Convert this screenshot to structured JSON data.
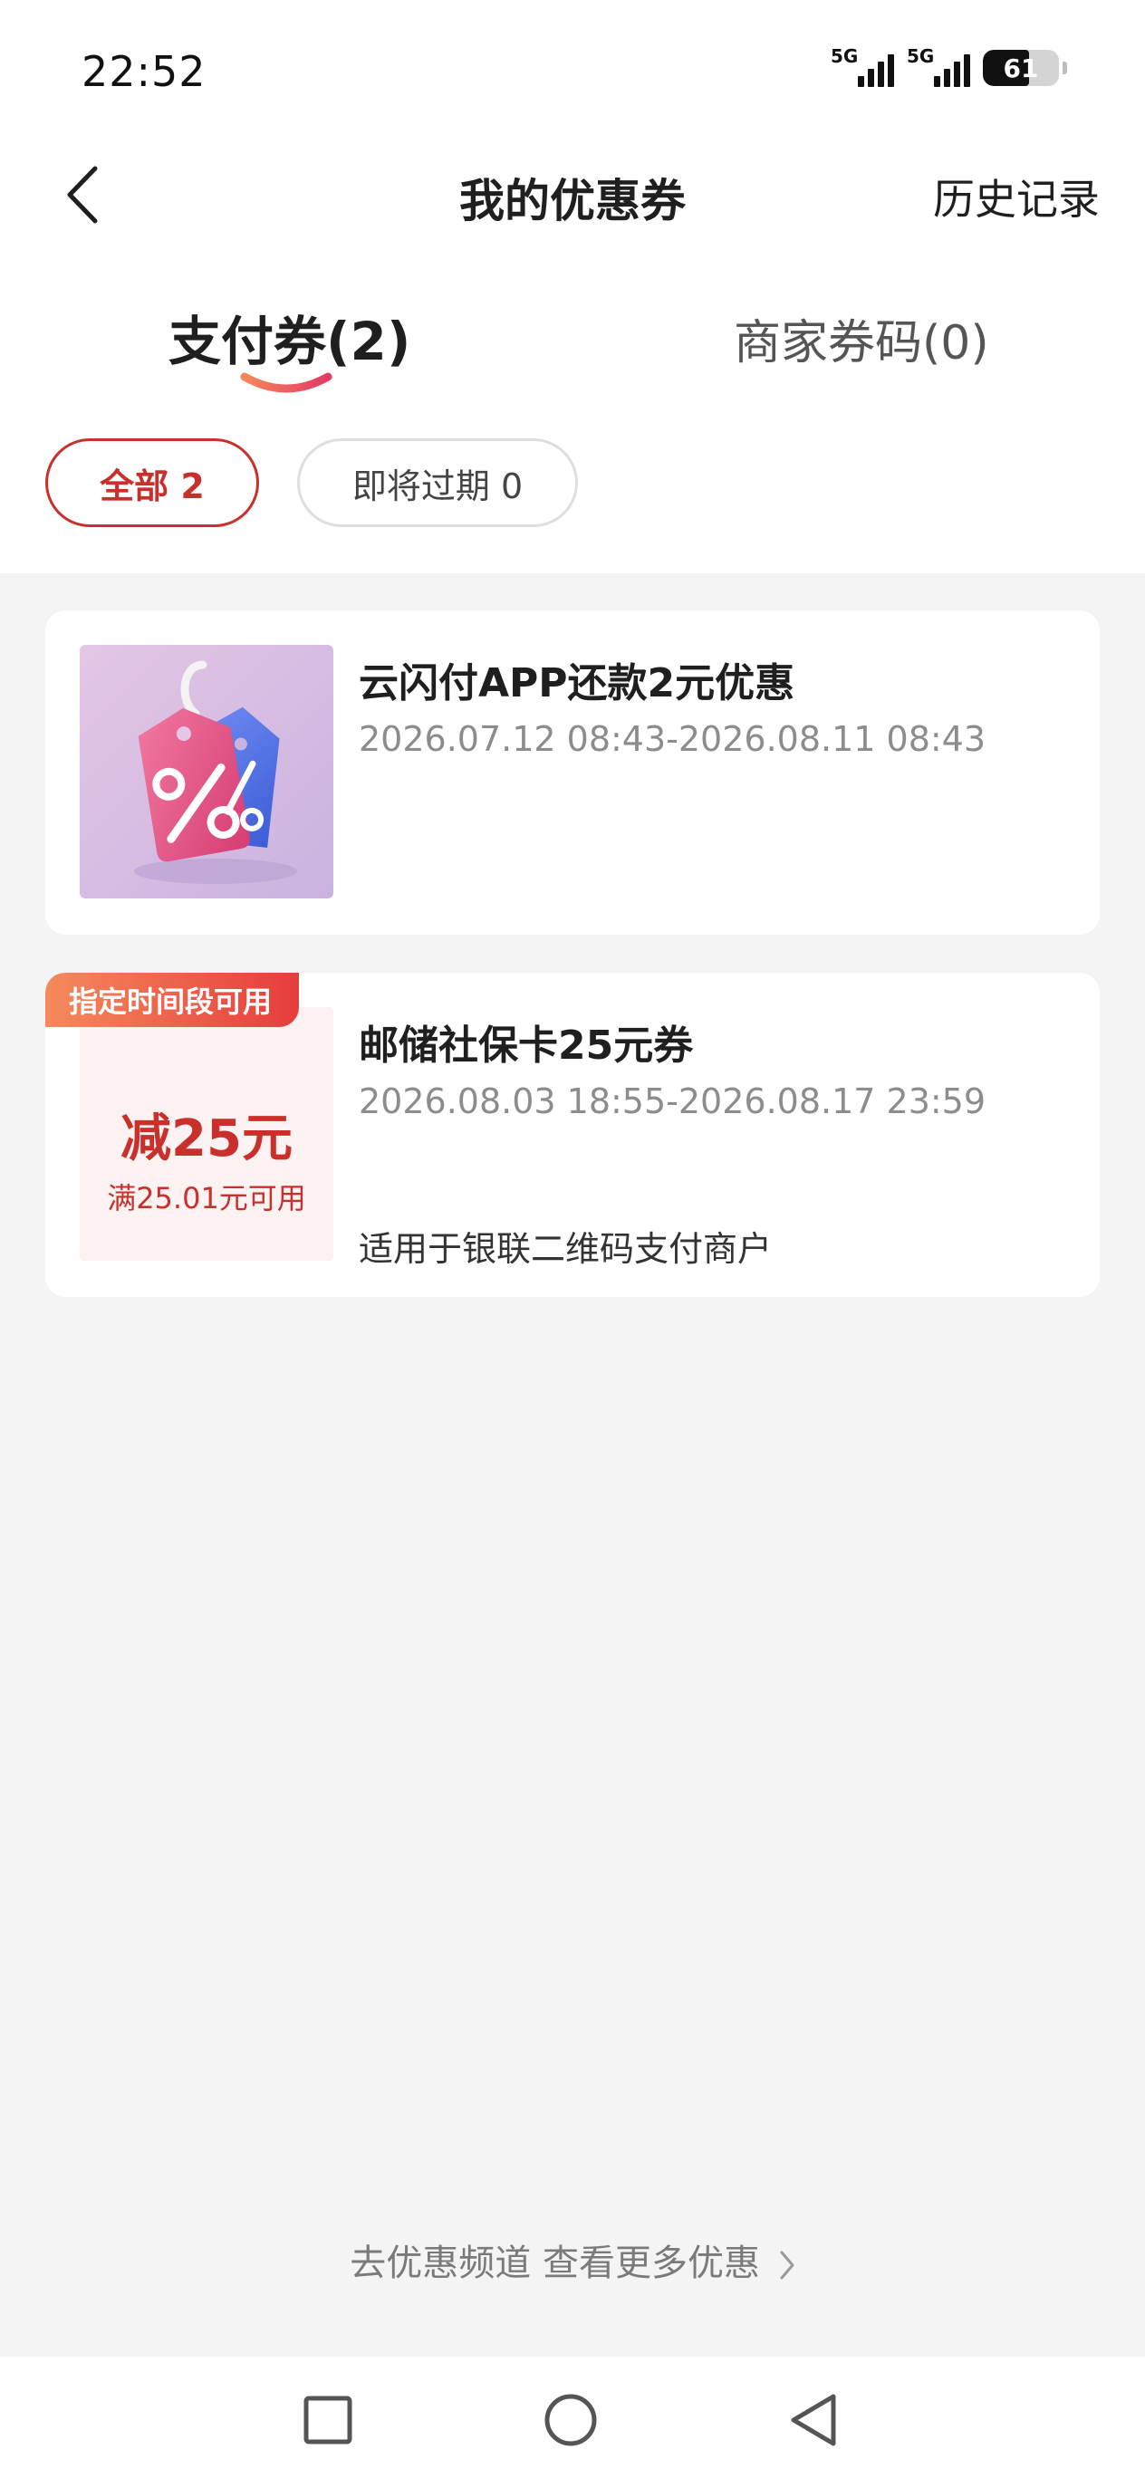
{
  "status_bar": {
    "time": "22:52",
    "network_1": "5G",
    "network_2": "5G",
    "battery_level": "61",
    "battery_fraction": 0.61
  },
  "header": {
    "title": "我的优惠券",
    "history_label": "历史记录",
    "back_icon": "chevron-left-icon"
  },
  "tabs": {
    "pay_coupons": "支付券(2)",
    "merchant_codes": "商家券码(0)",
    "active": "pay_coupons",
    "underline_color": "#e8493f"
  },
  "filters": {
    "all": "全部 2",
    "expiring": "即将过期 0",
    "active": "all"
  },
  "coupons": [
    {
      "title": "云闪付APP还款2元优惠",
      "period": "2026.07.12 08:43-2026.08.11 08:43",
      "image_icon": "price-tags-icon"
    },
    {
      "badge": "指定时间段可用",
      "amount": "减25元",
      "condition": "满25.01元可用",
      "title": "邮储社保卡25元券",
      "period": "2026.08.03 18:55-2026.08.17 23:59",
      "note": "适用于银联二维码支付商户"
    }
  ],
  "footer": {
    "more_link": "去优惠频道 查看更多优惠"
  },
  "colors": {
    "accent": "#c9302c",
    "background": "#f4f4f4",
    "card": "#ffffff"
  }
}
